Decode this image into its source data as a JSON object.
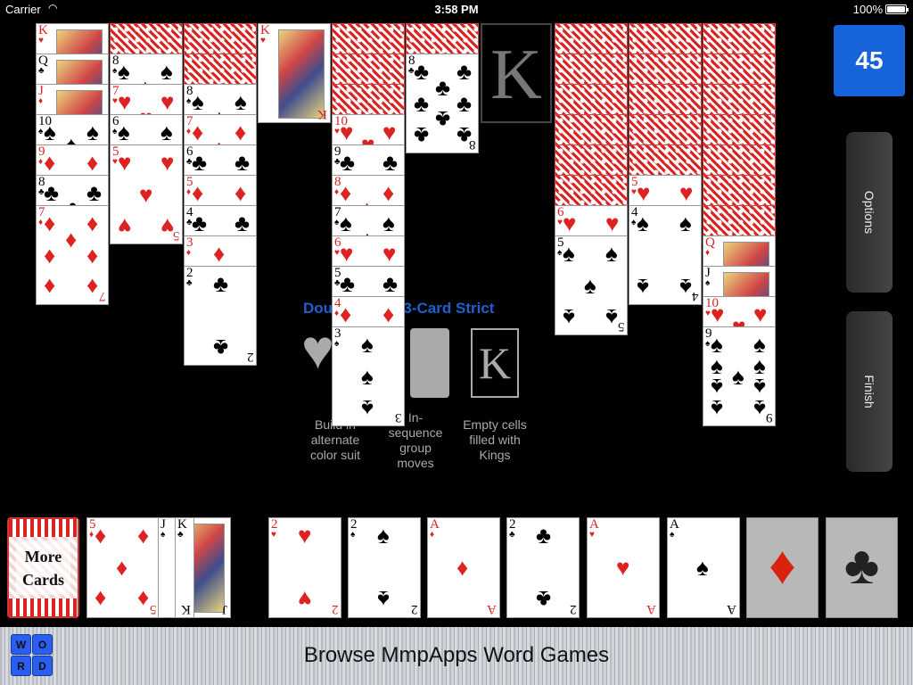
{
  "status_bar": {
    "carrier": "Carrier",
    "time": "3:58 PM",
    "battery": "100%"
  },
  "score": "45",
  "side_buttons": {
    "options": "Options",
    "finish": "Finish"
  },
  "background_info": {
    "title": "Double Spike 3-Card Strict",
    "features": [
      {
        "icon": "heart-icon",
        "caption": "Build in alternate color suit"
      },
      {
        "icon": "card-group-icon",
        "caption": "In-sequence group moves"
      },
      {
        "icon": "king-slot-icon",
        "caption": "Empty cells filled with Kings"
      }
    ]
  },
  "empty_slot_label": "K",
  "tableau": [
    {
      "face_down": 0,
      "cards": [
        {
          "r": "K",
          "s": "♥"
        },
        {
          "r": "Q",
          "s": "♣"
        },
        {
          "r": "J",
          "s": "♦"
        },
        {
          "r": "10",
          "s": "♠"
        },
        {
          "r": "9",
          "s": "♦"
        },
        {
          "r": "8",
          "s": "♣"
        },
        {
          "r": "7",
          "s": "♦"
        }
      ]
    },
    {
      "face_down": 1,
      "cards": [
        {
          "r": "8",
          "s": "♠"
        },
        {
          "r": "7",
          "s": "♥"
        },
        {
          "r": "6",
          "s": "♠"
        },
        {
          "r": "5",
          "s": "♥"
        }
      ]
    },
    {
      "face_down": 2,
      "cards": [
        {
          "r": "8",
          "s": "♠"
        },
        {
          "r": "7",
          "s": "♦"
        },
        {
          "r": "6",
          "s": "♣"
        },
        {
          "r": "5",
          "s": "♦"
        },
        {
          "r": "4",
          "s": "♣"
        },
        {
          "r": "3",
          "s": "♦"
        },
        {
          "r": "2",
          "s": "♣"
        }
      ]
    },
    {
      "face_down": 0,
      "cards": [
        {
          "r": "K",
          "s": "♥"
        }
      ]
    },
    {
      "face_down": 3,
      "cards": [
        {
          "r": "10",
          "s": "♥"
        },
        {
          "r": "9",
          "s": "♣"
        },
        {
          "r": "8",
          "s": "♦"
        },
        {
          "r": "7",
          "s": "♠"
        },
        {
          "r": "6",
          "s": "♥"
        },
        {
          "r": "5",
          "s": "♣"
        },
        {
          "r": "4",
          "s": "♦"
        },
        {
          "r": "3",
          "s": "♠"
        }
      ]
    },
    {
      "face_down": 1,
      "cards": [
        {
          "r": "8",
          "s": "♣"
        }
      ]
    },
    {
      "empty": true
    },
    {
      "face_down": 6,
      "cards": [
        {
          "r": "6",
          "s": "♥"
        },
        {
          "r": "5",
          "s": "♠"
        }
      ]
    },
    {
      "face_down": 5,
      "cards": [
        {
          "r": "5",
          "s": "♥"
        },
        {
          "r": "4",
          "s": "♠"
        }
      ]
    },
    {
      "face_down": 7,
      "cards": [
        {
          "r": "Q",
          "s": "♦"
        },
        {
          "r": "J",
          "s": "♠"
        },
        {
          "r": "10",
          "s": "♥"
        },
        {
          "r": "9",
          "s": "♠"
        }
      ]
    }
  ],
  "stock": {
    "label_line1": "More",
    "label_line2": "Cards"
  },
  "waste": [
    {
      "r": "5",
      "s": "♦"
    },
    {
      "r": "J",
      "s": "♠"
    },
    {
      "r": "K",
      "s": "♣"
    }
  ],
  "foundations": [
    {
      "r": "2",
      "s": "♥"
    },
    {
      "r": "2",
      "s": "♠"
    },
    {
      "r": "A",
      "s": "♦"
    },
    {
      "r": "2",
      "s": "♣"
    },
    {
      "r": "A",
      "s": "♥"
    },
    {
      "r": "A",
      "s": "♠"
    },
    {
      "empty": true,
      "s": "♦"
    },
    {
      "empty": true,
      "s": "♣"
    }
  ],
  "banner": {
    "text": "Browse MmpApps Word Games",
    "logo_letters": [
      "W",
      "O",
      "R",
      "D"
    ]
  }
}
